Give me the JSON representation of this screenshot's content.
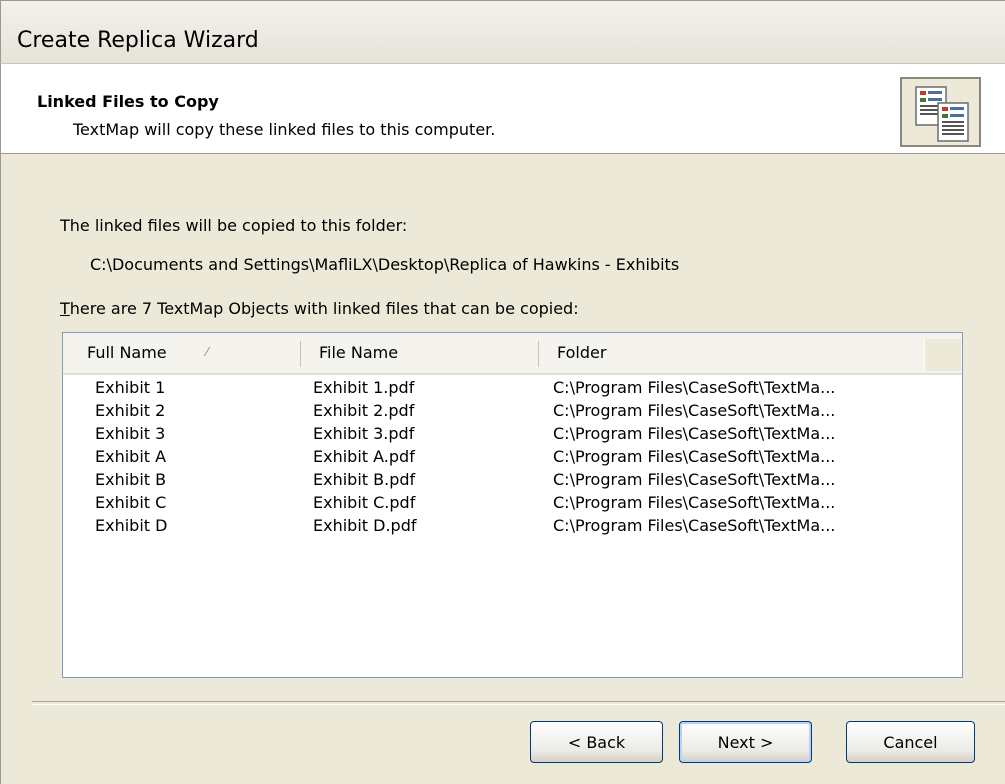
{
  "window": {
    "title": "Create Replica Wizard"
  },
  "header": {
    "title": "Linked Files to Copy",
    "subtitle": "TextMap will copy these linked files to this computer.",
    "icon": "copy-documents-icon"
  },
  "body": {
    "folder_label": "The linked files will be copied to this folder:",
    "folder_path": "C:\\Documents and Settings\\MafliLX\\Desktop\\Replica of Hawkins - Exhibits",
    "objects_label": "There are 7 TextMap Objects with linked files that can be copied:",
    "objects_label_mnemonic": "T",
    "objects_label_rest": "here are 7 TextMap Objects with linked files that can be copied:"
  },
  "list": {
    "columns": [
      "Full Name",
      "File Name",
      "Folder"
    ],
    "rows": [
      {
        "full_name": "Exhibit 1",
        "file_name": "Exhibit 1.pdf",
        "folder": "C:\\Program Files\\CaseSoft\\TextMa..."
      },
      {
        "full_name": "Exhibit 2",
        "file_name": "Exhibit 2.pdf",
        "folder": "C:\\Program Files\\CaseSoft\\TextMa..."
      },
      {
        "full_name": "Exhibit 3",
        "file_name": "Exhibit 3.pdf",
        "folder": "C:\\Program Files\\CaseSoft\\TextMa..."
      },
      {
        "full_name": "Exhibit A",
        "file_name": "Exhibit A.pdf",
        "folder": "C:\\Program Files\\CaseSoft\\TextMa..."
      },
      {
        "full_name": "Exhibit B",
        "file_name": "Exhibit B.pdf",
        "folder": "C:\\Program Files\\CaseSoft\\TextMa..."
      },
      {
        "full_name": "Exhibit C",
        "file_name": "Exhibit C.pdf",
        "folder": "C:\\Program Files\\CaseSoft\\TextMa..."
      },
      {
        "full_name": "Exhibit D",
        "file_name": "Exhibit D.pdf",
        "folder": "C:\\Program Files\\CaseSoft\\TextMa..."
      }
    ]
  },
  "buttons": {
    "back": "< Back",
    "next": "Next >",
    "cancel": "Cancel"
  }
}
